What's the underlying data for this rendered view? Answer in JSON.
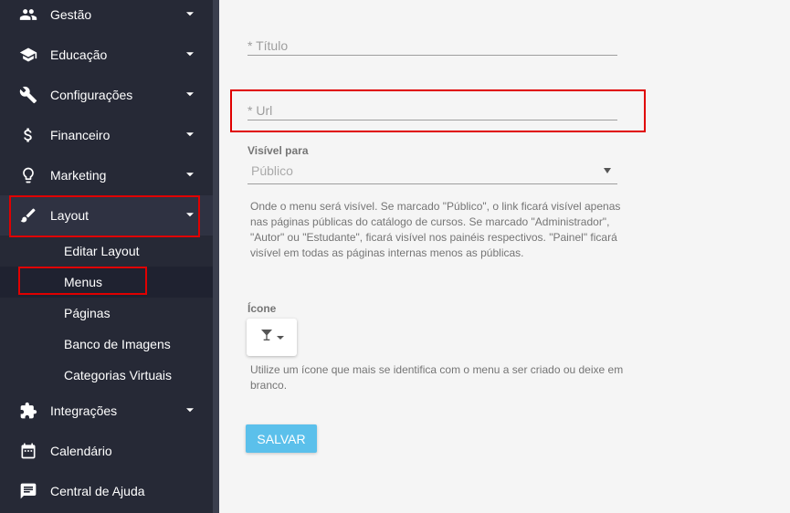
{
  "sidebar": {
    "items": [
      {
        "label": "Gestão",
        "icon": "people-icon",
        "has_caret": true
      },
      {
        "label": "Educação",
        "icon": "graduation-cap-icon",
        "has_caret": true
      },
      {
        "label": "Configurações",
        "icon": "wrench-icon",
        "has_caret": true
      },
      {
        "label": "Financeiro",
        "icon": "dollar-icon",
        "has_caret": true
      },
      {
        "label": "Marketing",
        "icon": "lightbulb-icon",
        "has_caret": true
      },
      {
        "label": "Layout",
        "icon": "brush-icon",
        "has_caret": true,
        "expanded": true
      },
      {
        "label": "Integrações",
        "icon": "puzzle-icon",
        "has_caret": true
      },
      {
        "label": "Calendário",
        "icon": "calendar-icon",
        "has_caret": false
      },
      {
        "label": "Central de Ajuda",
        "icon": "chat-icon",
        "has_caret": false
      }
    ],
    "layout_subitems": [
      {
        "label": "Editar Layout"
      },
      {
        "label": "Menus",
        "active": true
      },
      {
        "label": "Páginas"
      },
      {
        "label": "Banco de Imagens"
      },
      {
        "label": "Categorias Virtuais"
      }
    ]
  },
  "form": {
    "title_label": "* Título",
    "url_label": "* Url",
    "visible_label": "Visível para",
    "visible_value": "Público",
    "visible_help": "Onde o menu será visível. Se marcado \"Público\", o link ficará visível apenas nas páginas públicas do catálogo de cursos. Se marcado \"Administrador\", \"Autor\" ou \"Estudante\", ficará visível nos painéis respectivos. \"Painel\" ficará visível em todas as páginas internas menos as públicas.",
    "icon_label": "Ícone",
    "icon_value": "glass-icon",
    "icon_help": "Utilize um ícone que mais se identifica com o menu a ser criado ou deixe em branco.",
    "save_label": "SALVAR"
  },
  "colors": {
    "sidebar_bg": "#262936",
    "highlight": "#e00000",
    "save_button": "#5bc0eb"
  }
}
